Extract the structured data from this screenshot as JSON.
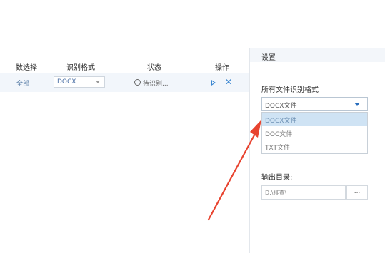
{
  "table": {
    "headers": [
      "数选择",
      "识别格式",
      "状态",
      "操作"
    ],
    "rows": [
      {
        "scope": "全部",
        "format": "DOCX",
        "status": "待识别..."
      }
    ]
  },
  "settings": {
    "title": "设置",
    "format_label": "所有文件识别格式",
    "format_selected": "DOCX文件",
    "format_options": [
      "DOCX文件",
      "DOC文件",
      "TXT文件"
    ],
    "output_label": "输出目录:",
    "output_path": "D:\\排查\\",
    "browse_label": "..."
  },
  "icons": {
    "status": "clock-icon",
    "start": "play-icon",
    "remove": "close-icon",
    "format_caret": "chevron-down-icon"
  },
  "colors": {
    "accent": "#3a86d0",
    "selected_option": "#cfe3f4",
    "annotation_arrow": "#e8432f"
  }
}
